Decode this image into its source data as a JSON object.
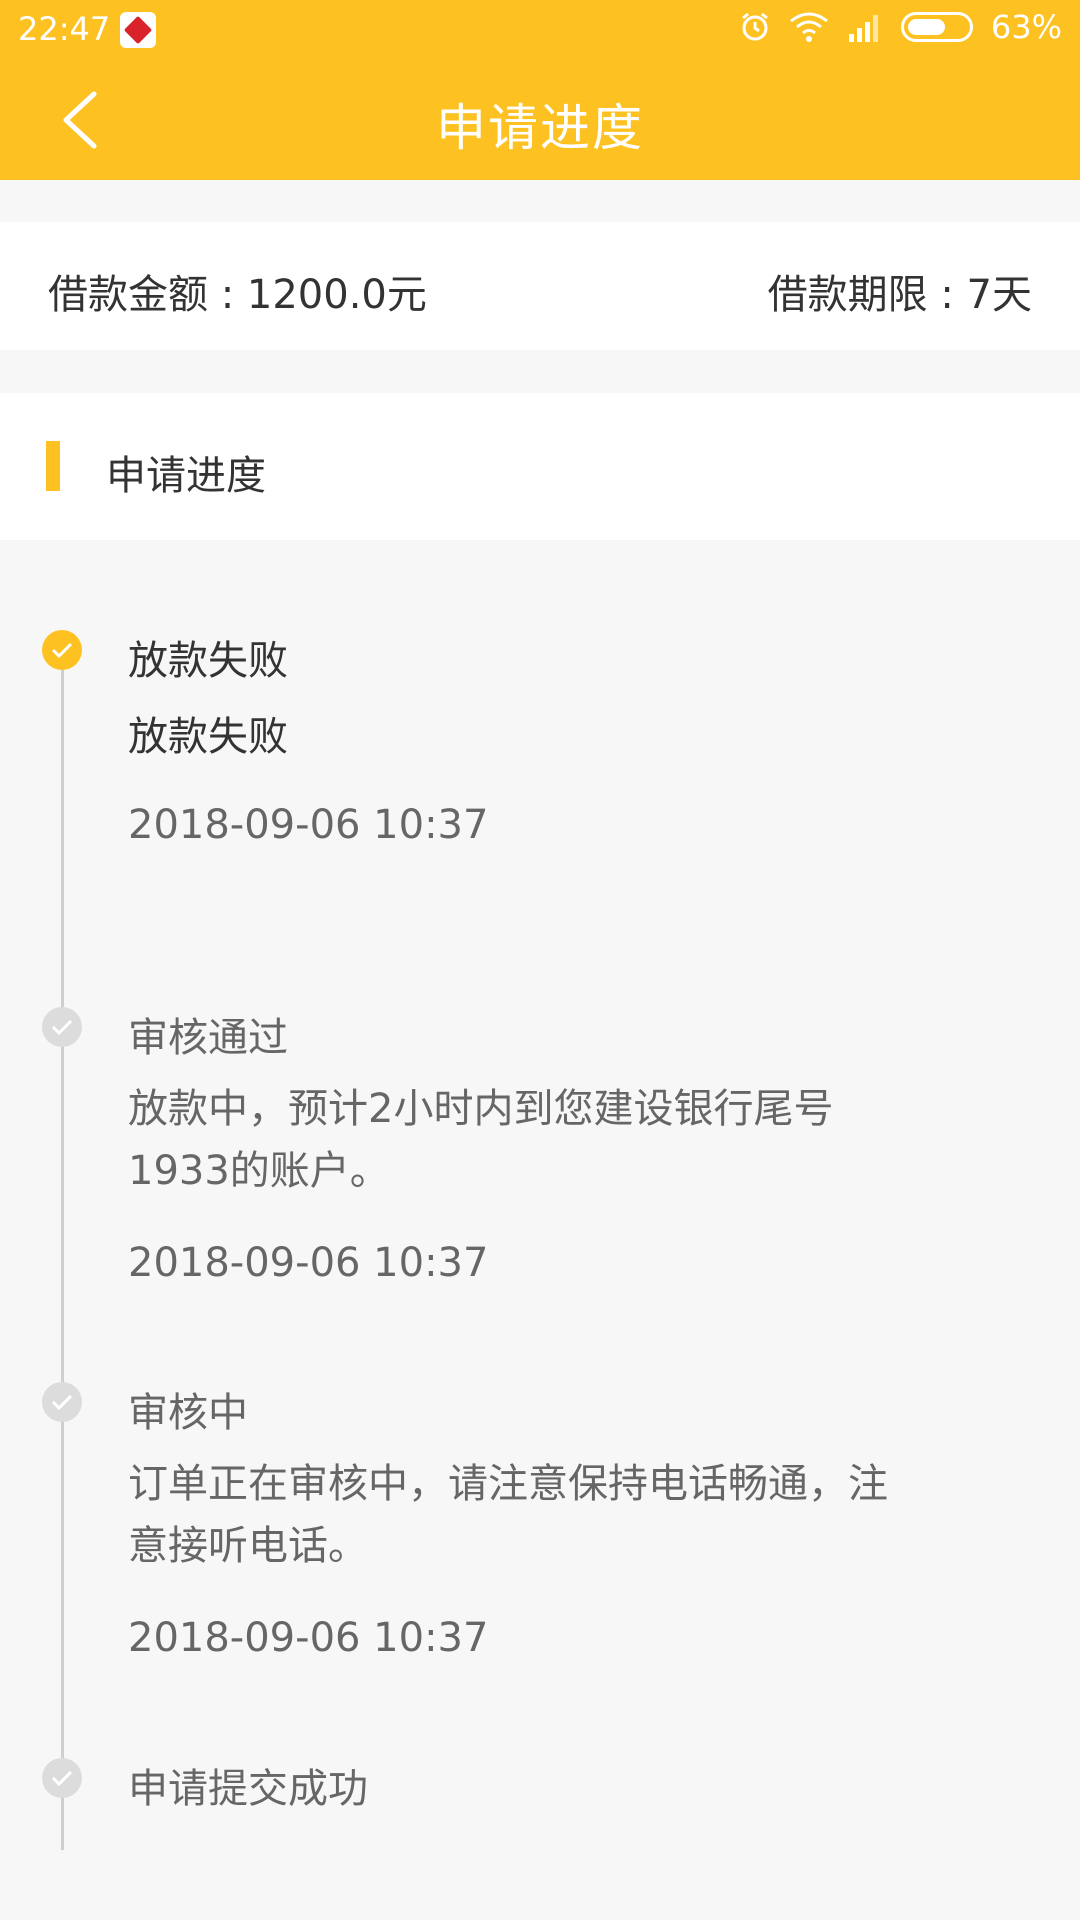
{
  "status_bar": {
    "time": "22:47",
    "battery": "63%",
    "battery_level": 0.63,
    "icons": [
      "alarm-icon",
      "wifi-icon",
      "signal-icon",
      "battery-icon"
    ]
  },
  "header": {
    "title": "申请进度",
    "back_icon": "chevron-left-icon"
  },
  "summary": {
    "amount": "借款金额 : 1200.0元",
    "term": "借款期限 : 7天"
  },
  "section": {
    "label": "申请进度"
  },
  "timeline": [
    {
      "status": "放款失败",
      "desc": "放款失败",
      "time": "2018-09-06 10:37",
      "active": true
    },
    {
      "status": "审核通过",
      "desc": "放款中，预计2小时内到您建设银行尾号1933的账户。",
      "time": "2018-09-06 10:37",
      "active": false
    },
    {
      "status": "审核中",
      "desc": "订单正在审核中，请注意保持电话畅通，注意接听电话。",
      "time": "2018-09-06 10:37",
      "active": false
    },
    {
      "status": "申请提交成功",
      "active": false
    }
  ],
  "colors": {
    "accent": "#fdc121",
    "background": "#f8f7f8",
    "text": "#333333",
    "muted": "#666666"
  }
}
